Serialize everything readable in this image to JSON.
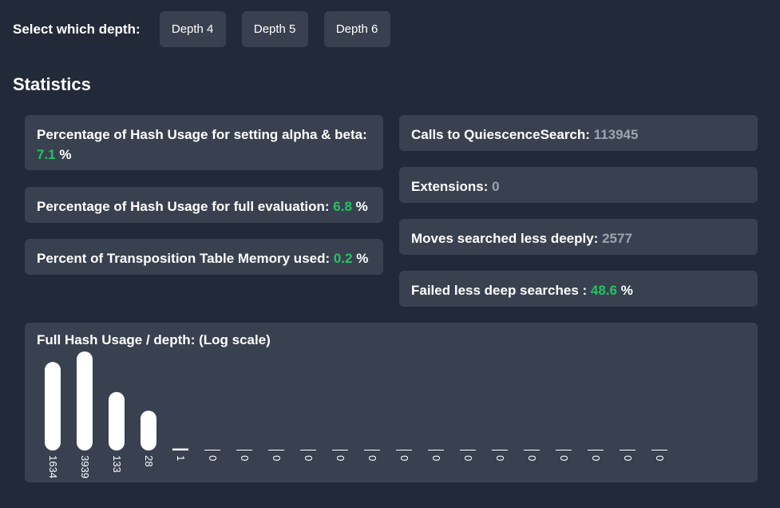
{
  "depth_selector": {
    "label": "Select which depth:",
    "buttons": [
      "Depth 4",
      "Depth 5",
      "Depth 6"
    ]
  },
  "statistics": {
    "title": "Statistics",
    "left_cards": [
      {
        "label": "Percentage of Hash Usage for setting alpha & beta:",
        "value": "7.1",
        "unit": "%"
      },
      {
        "label": "Percentage of Hash Usage for full evaluation:",
        "value": "6.8",
        "unit": "%"
      },
      {
        "label": "Percent of Transposition Table Memory used:",
        "value": "0.2",
        "unit": "%"
      }
    ],
    "right_cards": [
      {
        "label": "Calls to QuiescenceSearch:",
        "value": "113945",
        "unit": ""
      },
      {
        "label": "Extensions:",
        "value": "0",
        "unit": ""
      },
      {
        "label": "Moves searched less deeply:",
        "value": "2577",
        "unit": ""
      },
      {
        "label": "Failed less deep searches :",
        "value": "48.6",
        "unit": "%"
      }
    ]
  },
  "colors": {
    "background": "#222938",
    "card": "#394150",
    "green_value": "#22c55e",
    "gray_value": "#9ca3af",
    "bar": "#ffffff"
  },
  "chart_data": {
    "type": "bar",
    "title": "Full Hash Usage / depth: (Log scale)",
    "scale": "log",
    "grid": false,
    "values": [
      1634,
      3939,
      133,
      28,
      1,
      0,
      0,
      0,
      0,
      0,
      0,
      0,
      0,
      0,
      0,
      0,
      0,
      0,
      0,
      0
    ]
  }
}
